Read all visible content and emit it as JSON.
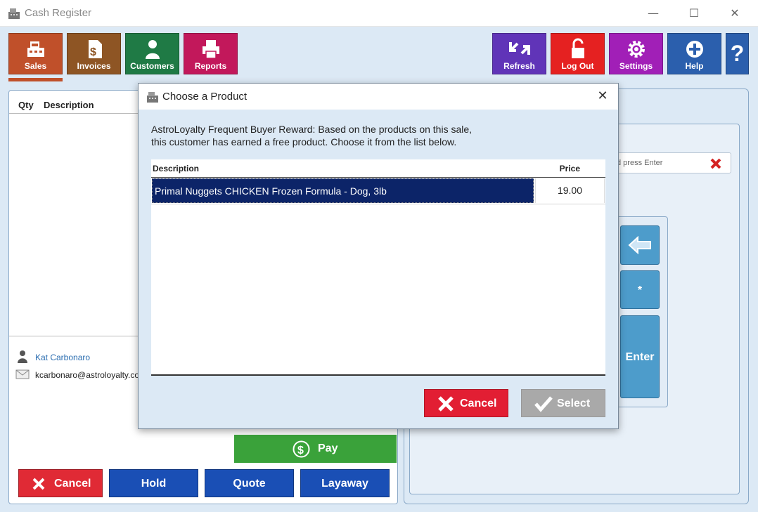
{
  "window": {
    "title": "Cash Register",
    "minimize": "—",
    "maximize": "☐",
    "close": "✕"
  },
  "toolbar": {
    "left": [
      {
        "label": "Sales",
        "color": "#c0502a",
        "icon": "cash-register-icon"
      },
      {
        "label": "Invoices",
        "color": "#8e5524",
        "icon": "invoice-icon"
      },
      {
        "label": "Customers",
        "color": "#1f7a45",
        "icon": "customer-icon"
      },
      {
        "label": "Reports",
        "color": "#c2185b",
        "icon": "printer-icon"
      }
    ],
    "right": [
      {
        "label": "Refresh",
        "color": "#6034b8",
        "icon": "refresh-icon"
      },
      {
        "label": "Log Out",
        "color": "#e52121",
        "icon": "lock-icon"
      },
      {
        "label": "Settings",
        "color": "#a11fb7",
        "icon": "gear-icon"
      },
      {
        "label": "Help",
        "color": "#2b5fad",
        "icon": "plus-circle-icon"
      }
    ],
    "help_glyph": "?"
  },
  "grid": {
    "qty_header": "Qty",
    "desc_header": "Description"
  },
  "customer": {
    "name": "Kat Carbonaro",
    "email": "kcarbonaro@astroloyalty.com"
  },
  "search": {
    "placeholder": "d press Enter"
  },
  "keypad": {
    "star": "*",
    "enter": "Enter"
  },
  "pay": {
    "label": "Pay"
  },
  "bottom_buttons": {
    "cancel": "Cancel",
    "hold": "Hold",
    "quote": "Quote",
    "layaway": "Layaway"
  },
  "dialog": {
    "title": "Choose a Product",
    "message_line1": "AstroLoyalty Frequent Buyer Reward: Based on the products on this sale,",
    "message_line2": "this customer has earned a free product. Choose it from the list below.",
    "columns": {
      "description": "Description",
      "price": "Price"
    },
    "rows": [
      {
        "description": "Primal Nuggets CHICKEN Frozen Formula - Dog, 3lb",
        "price": "19.00",
        "selected": true
      }
    ],
    "cancel": "Cancel",
    "select": "Select"
  }
}
